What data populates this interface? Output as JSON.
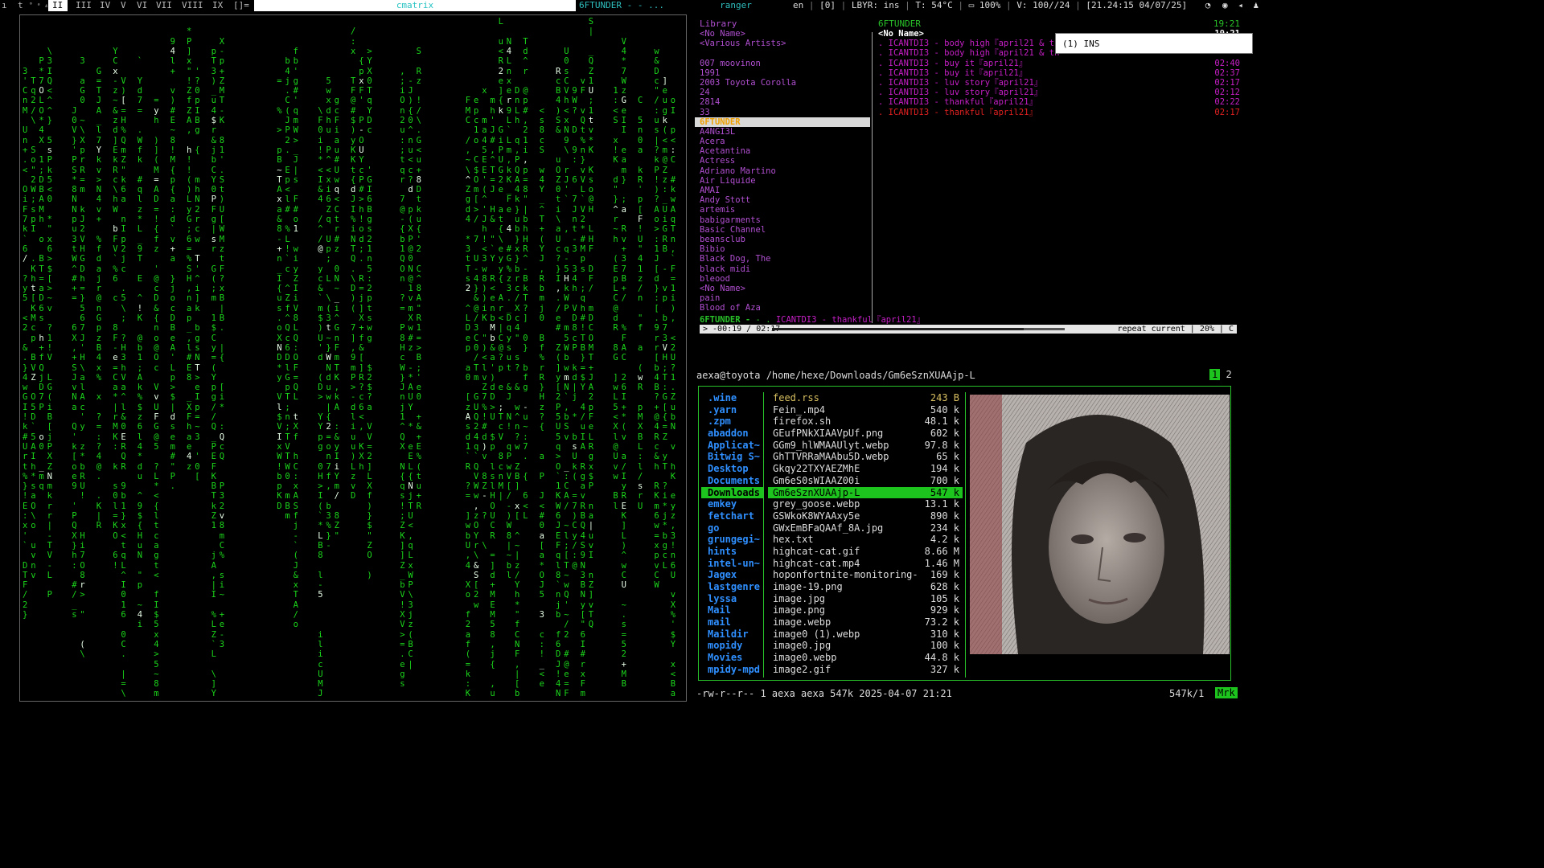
{
  "topbar": {
    "left_glyphs": [
      "ı",
      "t",
      "° ᵃ ₄"
    ],
    "workspaces": [
      "II",
      "III",
      "IV",
      "V",
      "VI",
      "VII",
      "VIII",
      "IX"
    ],
    "active_workspace": "II",
    "layout": "[]=",
    "window_title": "cmatrix",
    "tab2": "6FTUNDER -  - ...",
    "tab3": "ranger",
    "status": {
      "lang": "en",
      "badge": "[0]",
      "layer": "LBYR: ins",
      "temp": "T: 54°C",
      "battery": "100%",
      "volume": "V: 100//24",
      "datetime": "[21.24:15 04/07/25]"
    }
  },
  "matrix": {
    "color": "#1bd61b",
    "bright_color": "#e8ffe8"
  },
  "music": {
    "library_title": "Library",
    "artists": [
      "<No Name>",
      "<Various Artists>",
      "",
      "007 moovinon",
      "1991",
      "2003 Toyota Corolla",
      "24",
      "2814",
      "33",
      "6FTUNDER",
      "A4NGI3L",
      "Acera",
      "Acetantina",
      "Actress",
      "Adriano Martino",
      "Air Liquide",
      "AMAI",
      "Andy Stott",
      "artemis",
      "babigarments",
      "Basic Channel",
      "beansclub",
      "Bibio",
      "Black Dog, The",
      "black midi",
      "bleood",
      "  <No Name>",
      "  pain",
      "Blood of Aza"
    ],
    "selected_artist": "6FTUNDER",
    "track_header": {
      "artist": "6FTUNDER",
      "time": "19:21"
    },
    "tracks": [
      {
        "title": "<No Name>",
        "duration": "19:21",
        "kind": "hdr"
      },
      {
        "title": ". ICANTDI3 - body high『april21 & th",
        "duration": "",
        "kind": ""
      },
      {
        "title": ". ICANTDI3 - body high『april21 & th",
        "duration": "",
        "kind": ""
      },
      {
        "title": ". ICANTDI3 - buy it『april21』",
        "duration": "02:40",
        "kind": ""
      },
      {
        "title": ". ICANTDI3 - buy it『april21』",
        "duration": "02:37",
        "kind": ""
      },
      {
        "title": ". ICANTDI3 - luv story『april21』",
        "duration": "02:17",
        "kind": ""
      },
      {
        "title": ". ICANTDI3 - luv story『april21』",
        "duration": "02:12",
        "kind": ""
      },
      {
        "title": ". ICANTDI3 - thankful『april21』",
        "duration": "02:22",
        "kind": ""
      },
      {
        "title": ". ICANTDI3 - thankful『april21』",
        "duration": "02:17",
        "kind": "cur"
      }
    ],
    "popup": "(1) INS",
    "now_playing": {
      "artist": "6FTUNDER - ",
      "sep": " - . ",
      "title": "ICANTDI3 - thankful『april21』"
    },
    "progress": {
      "remaining": "> -00:19 / 02:17",
      "fraction": 0.86,
      "mode": "repeat current | 20% | C"
    }
  },
  "ranger": {
    "path": "aexa@toyota /home/hexe/Downloads/Gm6eSznXUAAjp-L",
    "tabs": [
      "1",
      "2"
    ],
    "dirs": [
      ".wine",
      ".yarn",
      ".zpm",
      "abaddon",
      "Applicat~",
      "Bitwig S~",
      "Desktop",
      "Documents",
      "Downloads",
      "emkey",
      "fetchart",
      "go",
      "grungegi~",
      "hints",
      "intel-un~",
      "Jagex",
      "lastgenre",
      "lyssa",
      "Mail",
      "mail",
      "Maildir",
      "mopidy",
      "Movies",
      "mpidy-mpd"
    ],
    "selected_dir": "Downloads",
    "files": [
      {
        "name": "feed.rss",
        "size": "243 B"
      },
      {
        "name": "Fein_.mp4",
        "size": "540 k"
      },
      {
        "name": "firefox.sh",
        "size": "48.1 k"
      },
      {
        "name": "GEufPNkXIAAVpUf.png",
        "size": "602 k"
      },
      {
        "name": "GGm9_hlWMAAUlyt.webp",
        "size": "97.8 k"
      },
      {
        "name": "GhTTVRRaMAAbu5D.webp",
        "size": "65 k"
      },
      {
        "name": "Gkqy22TXYAEZMhE",
        "size": "194 k"
      },
      {
        "name": "Gm6eS0sWIAAZ00i",
        "size": "700 k"
      },
      {
        "name": " Gm6eSznXUAAjp-L",
        "size": "547 k"
      },
      {
        "name": "grey_goose.webp",
        "size": "13.1 k"
      },
      {
        "name": "GSWkoK8WYAAxy5e",
        "size": "890 k"
      },
      {
        "name": "GWxEmBFaQAAf_8A.jpg",
        "size": "234 k"
      },
      {
        "name": "hex.txt",
        "size": "4.2 k"
      },
      {
        "name": "highcat-cat.gif",
        "size": "8.66 M"
      },
      {
        "name": "highcat-cat.mp4",
        "size": "1.46 M"
      },
      {
        "name": "hoponfortnite-monitoring-~",
        "size": "169 k"
      },
      {
        "name": "image-19.png",
        "size": "628 k"
      },
      {
        "name": "image.jpg",
        "size": "105 k"
      },
      {
        "name": "image.png",
        "size": "929 k"
      },
      {
        "name": "image.webp",
        "size": "73.2 k"
      },
      {
        "name": "image0 (1).webp",
        "size": "310 k"
      },
      {
        "name": "image0.jpg",
        "size": "100 k"
      },
      {
        "name": "image0.webp",
        "size": "44.8 k"
      },
      {
        "name": "image2.gif",
        "size": "327 k"
      }
    ],
    "selected_file": " Gm6eSznXUAAjp-L",
    "status_left": "-rw-r--r-- 1 aexa aexa 547k 2025-04-07 21:21",
    "status_right": "547k/1",
    "status_mark": "Mrk"
  }
}
